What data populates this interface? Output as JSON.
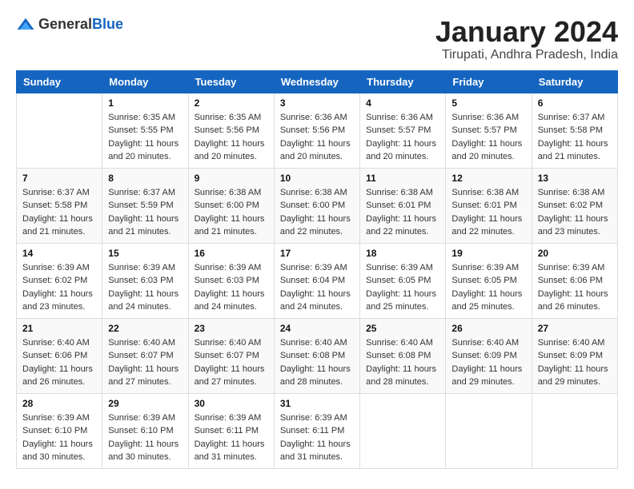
{
  "logo": {
    "text_general": "General",
    "text_blue": "Blue"
  },
  "header": {
    "month_title": "January 2024",
    "location": "Tirupati, Andhra Pradesh, India"
  },
  "weekdays": [
    "Sunday",
    "Monday",
    "Tuesday",
    "Wednesday",
    "Thursday",
    "Friday",
    "Saturday"
  ],
  "weeks": [
    [
      {
        "day": "",
        "sunrise": "",
        "sunset": "",
        "daylight": ""
      },
      {
        "day": "1",
        "sunrise": "Sunrise: 6:35 AM",
        "sunset": "Sunset: 5:55 PM",
        "daylight": "Daylight: 11 hours and 20 minutes."
      },
      {
        "day": "2",
        "sunrise": "Sunrise: 6:35 AM",
        "sunset": "Sunset: 5:56 PM",
        "daylight": "Daylight: 11 hours and 20 minutes."
      },
      {
        "day": "3",
        "sunrise": "Sunrise: 6:36 AM",
        "sunset": "Sunset: 5:56 PM",
        "daylight": "Daylight: 11 hours and 20 minutes."
      },
      {
        "day": "4",
        "sunrise": "Sunrise: 6:36 AM",
        "sunset": "Sunset: 5:57 PM",
        "daylight": "Daylight: 11 hours and 20 minutes."
      },
      {
        "day": "5",
        "sunrise": "Sunrise: 6:36 AM",
        "sunset": "Sunset: 5:57 PM",
        "daylight": "Daylight: 11 hours and 20 minutes."
      },
      {
        "day": "6",
        "sunrise": "Sunrise: 6:37 AM",
        "sunset": "Sunset: 5:58 PM",
        "daylight": "Daylight: 11 hours and 21 minutes."
      }
    ],
    [
      {
        "day": "7",
        "sunrise": "Sunrise: 6:37 AM",
        "sunset": "Sunset: 5:58 PM",
        "daylight": "Daylight: 11 hours and 21 minutes."
      },
      {
        "day": "8",
        "sunrise": "Sunrise: 6:37 AM",
        "sunset": "Sunset: 5:59 PM",
        "daylight": "Daylight: 11 hours and 21 minutes."
      },
      {
        "day": "9",
        "sunrise": "Sunrise: 6:38 AM",
        "sunset": "Sunset: 6:00 PM",
        "daylight": "Daylight: 11 hours and 21 minutes."
      },
      {
        "day": "10",
        "sunrise": "Sunrise: 6:38 AM",
        "sunset": "Sunset: 6:00 PM",
        "daylight": "Daylight: 11 hours and 22 minutes."
      },
      {
        "day": "11",
        "sunrise": "Sunrise: 6:38 AM",
        "sunset": "Sunset: 6:01 PM",
        "daylight": "Daylight: 11 hours and 22 minutes."
      },
      {
        "day": "12",
        "sunrise": "Sunrise: 6:38 AM",
        "sunset": "Sunset: 6:01 PM",
        "daylight": "Daylight: 11 hours and 22 minutes."
      },
      {
        "day": "13",
        "sunrise": "Sunrise: 6:38 AM",
        "sunset": "Sunset: 6:02 PM",
        "daylight": "Daylight: 11 hours and 23 minutes."
      }
    ],
    [
      {
        "day": "14",
        "sunrise": "Sunrise: 6:39 AM",
        "sunset": "Sunset: 6:02 PM",
        "daylight": "Daylight: 11 hours and 23 minutes."
      },
      {
        "day": "15",
        "sunrise": "Sunrise: 6:39 AM",
        "sunset": "Sunset: 6:03 PM",
        "daylight": "Daylight: 11 hours and 24 minutes."
      },
      {
        "day": "16",
        "sunrise": "Sunrise: 6:39 AM",
        "sunset": "Sunset: 6:03 PM",
        "daylight": "Daylight: 11 hours and 24 minutes."
      },
      {
        "day": "17",
        "sunrise": "Sunrise: 6:39 AM",
        "sunset": "Sunset: 6:04 PM",
        "daylight": "Daylight: 11 hours and 24 minutes."
      },
      {
        "day": "18",
        "sunrise": "Sunrise: 6:39 AM",
        "sunset": "Sunset: 6:05 PM",
        "daylight": "Daylight: 11 hours and 25 minutes."
      },
      {
        "day": "19",
        "sunrise": "Sunrise: 6:39 AM",
        "sunset": "Sunset: 6:05 PM",
        "daylight": "Daylight: 11 hours and 25 minutes."
      },
      {
        "day": "20",
        "sunrise": "Sunrise: 6:39 AM",
        "sunset": "Sunset: 6:06 PM",
        "daylight": "Daylight: 11 hours and 26 minutes."
      }
    ],
    [
      {
        "day": "21",
        "sunrise": "Sunrise: 6:40 AM",
        "sunset": "Sunset: 6:06 PM",
        "daylight": "Daylight: 11 hours and 26 minutes."
      },
      {
        "day": "22",
        "sunrise": "Sunrise: 6:40 AM",
        "sunset": "Sunset: 6:07 PM",
        "daylight": "Daylight: 11 hours and 27 minutes."
      },
      {
        "day": "23",
        "sunrise": "Sunrise: 6:40 AM",
        "sunset": "Sunset: 6:07 PM",
        "daylight": "Daylight: 11 hours and 27 minutes."
      },
      {
        "day": "24",
        "sunrise": "Sunrise: 6:40 AM",
        "sunset": "Sunset: 6:08 PM",
        "daylight": "Daylight: 11 hours and 28 minutes."
      },
      {
        "day": "25",
        "sunrise": "Sunrise: 6:40 AM",
        "sunset": "Sunset: 6:08 PM",
        "daylight": "Daylight: 11 hours and 28 minutes."
      },
      {
        "day": "26",
        "sunrise": "Sunrise: 6:40 AM",
        "sunset": "Sunset: 6:09 PM",
        "daylight": "Daylight: 11 hours and 29 minutes."
      },
      {
        "day": "27",
        "sunrise": "Sunrise: 6:40 AM",
        "sunset": "Sunset: 6:09 PM",
        "daylight": "Daylight: 11 hours and 29 minutes."
      }
    ],
    [
      {
        "day": "28",
        "sunrise": "Sunrise: 6:39 AM",
        "sunset": "Sunset: 6:10 PM",
        "daylight": "Daylight: 11 hours and 30 minutes."
      },
      {
        "day": "29",
        "sunrise": "Sunrise: 6:39 AM",
        "sunset": "Sunset: 6:10 PM",
        "daylight": "Daylight: 11 hours and 30 minutes."
      },
      {
        "day": "30",
        "sunrise": "Sunrise: 6:39 AM",
        "sunset": "Sunset: 6:11 PM",
        "daylight": "Daylight: 11 hours and 31 minutes."
      },
      {
        "day": "31",
        "sunrise": "Sunrise: 6:39 AM",
        "sunset": "Sunset: 6:11 PM",
        "daylight": "Daylight: 11 hours and 31 minutes."
      },
      {
        "day": "",
        "sunrise": "",
        "sunset": "",
        "daylight": ""
      },
      {
        "day": "",
        "sunrise": "",
        "sunset": "",
        "daylight": ""
      },
      {
        "day": "",
        "sunrise": "",
        "sunset": "",
        "daylight": ""
      }
    ]
  ]
}
